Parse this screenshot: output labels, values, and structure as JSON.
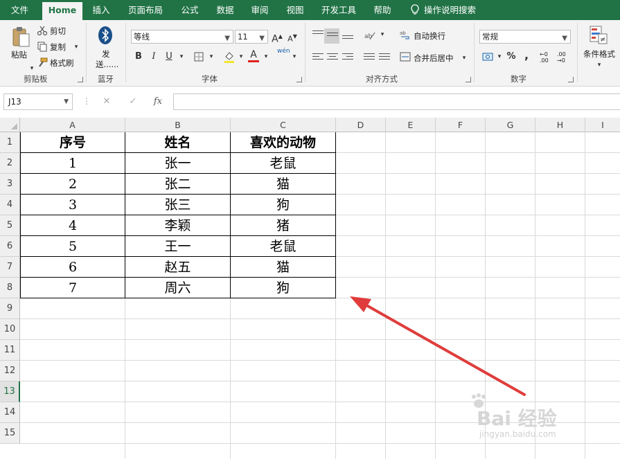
{
  "ribbon_tabs": [
    "文件",
    "Home",
    "插入",
    "页面布局",
    "公式",
    "数据",
    "审阅",
    "视图",
    "开发工具",
    "帮助",
    "操作说明搜索"
  ],
  "clipboard": {
    "paste": "粘贴",
    "cut": "剪切",
    "copy": "复制",
    "format_painter": "格式刷",
    "group": "剪贴板"
  },
  "bluetooth": {
    "send_1": "发",
    "send_2": "送......",
    "group": "蓝牙"
  },
  "font": {
    "name": "等线",
    "size": "11",
    "bold": "B",
    "italic": "I",
    "underline": "U",
    "grow": "A",
    "shrink": "A",
    "color_letter": "A",
    "phonetic": "wén",
    "group": "字体"
  },
  "alignment": {
    "wrap": "自动换行",
    "merge": "合并后居中",
    "group": "对齐方式"
  },
  "number": {
    "format": "常规",
    "percent": "%",
    "comma": ",",
    "inc_decimal": "←0 .00",
    "dec_decimal": ".00 →0",
    "group": "数字"
  },
  "styles": {
    "conditional": "条件格式"
  },
  "formula_bar": {
    "name_box": "J13",
    "cancel": "✕",
    "enter": "✓",
    "fx": "fx",
    "value": ""
  },
  "columns": [
    "A",
    "B",
    "C",
    "D",
    "E",
    "F",
    "G",
    "H",
    "I"
  ],
  "rows": [
    "1",
    "2",
    "3",
    "4",
    "5",
    "6",
    "7",
    "8",
    "9",
    "10",
    "11",
    "12",
    "13",
    "14",
    "15"
  ],
  "table": {
    "headers": [
      "序号",
      "姓名",
      "喜欢的动物"
    ],
    "rows": [
      [
        "1",
        "张一",
        "老鼠"
      ],
      [
        "2",
        "张二",
        "猫"
      ],
      [
        "3",
        "张三",
        "狗"
      ],
      [
        "4",
        "李颖",
        "猪"
      ],
      [
        "5",
        "王一",
        "老鼠"
      ],
      [
        "6",
        "赵五",
        "猫"
      ],
      [
        "7",
        "周六",
        "狗"
      ]
    ]
  },
  "watermark": {
    "brand": "Bai 经验",
    "url": "jingyan.baidu.com"
  },
  "colors": {
    "accent": "#217346",
    "arrow": "#e03c3c"
  }
}
